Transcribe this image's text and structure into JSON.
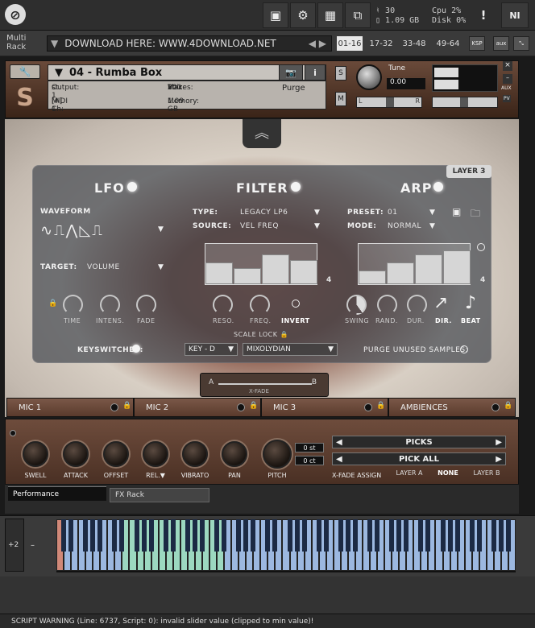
{
  "topbar": {
    "cpu_label": "Cpu",
    "cpu_value": "2%",
    "disk_label": "Disk",
    "disk_value": "0%",
    "voices": "30",
    "memory": "1.09 GB",
    "warn": "!"
  },
  "rack": {
    "title": "Multi Rack",
    "download": "DOWNLOAD HERE: WWW.4DOWNLOAD.NET",
    "tabs": [
      "01-16",
      "17-32",
      "33-48",
      "49-64"
    ],
    "ksp": "KSP",
    "aux": "aux"
  },
  "instrument": {
    "name": "04 - Rumba Box",
    "output_label": "Output:",
    "output": "st. 1",
    "voices_label": "Voices:",
    "voices": "30",
    "max_label": "Max:",
    "max": "200",
    "midi_label": "MIDI Ch:",
    "midi": "[A] 1",
    "memory_label": "Memory:",
    "memory": "1.09 GB",
    "purge": "Purge",
    "tune_label": "Tune",
    "tune": "0.00",
    "s": "S",
    "m": "M",
    "l": "L",
    "r": "R",
    "aux": "AUX",
    "pv": "PV"
  },
  "panel": {
    "layer": "LAYER 3",
    "lfo": {
      "title": "LFO",
      "waveform_label": "WAVEFORM",
      "target_label": "TARGET:",
      "target": "VOLUME",
      "knobs": [
        "TIME",
        "INTENS.",
        "FADE"
      ],
      "keyswitches": "KEYSWITCHES:"
    },
    "filter": {
      "title": "FILTER",
      "type_label": "TYPE:",
      "type": "LEGACY LP6",
      "source_label": "SOURCE:",
      "source": "VEL FREQ",
      "count": "4",
      "knobs": [
        "RESO.",
        "FREQ.",
        "INVERT"
      ],
      "bars": [
        0.55,
        0.4,
        0.75,
        0.6
      ]
    },
    "arp": {
      "title": "ARP",
      "preset_label": "PRESET:",
      "preset": "01",
      "mode_label": "MODE:",
      "mode": "NORMAL",
      "count": "4",
      "knobs": [
        "SWING",
        "RAND.",
        "DUR.",
        "DIR.",
        "BEAT"
      ],
      "bars": [
        0.35,
        0.55,
        0.75,
        0.85
      ],
      "purge": "PURGE UNUSED SAMPLES:"
    },
    "scale_lock": "SCALE LOCK",
    "key": "KEY - D",
    "scale": "MIXOLYDIAN"
  },
  "xfade": {
    "a": "A",
    "b": "B",
    "label": "X-FADE"
  },
  "mics": [
    "MIC 1",
    "MIC 2",
    "MIC 3",
    "AMBIENCES"
  ],
  "controls": {
    "knobs": [
      "SWELL",
      "ATTACK",
      "OFFSET",
      "REL.",
      "VIBRATO",
      "PAN",
      "PITCH"
    ],
    "st": "0 st",
    "ct": "0 ct",
    "picks": "PICKS",
    "pickall": "PICK ALL",
    "xfade_assign": "X-FADE ASSIGN",
    "layer_a": "LAYER A",
    "none": "NONE",
    "layer_b": "LAYER B"
  },
  "tabs": {
    "performance": "Performance",
    "fxrack": "FX Rack"
  },
  "keyboard": {
    "octave": "+2"
  },
  "status": "SCRIPT WARNING (Line: 6737, Script: 0):  invalid slider value (clipped to min value)!"
}
